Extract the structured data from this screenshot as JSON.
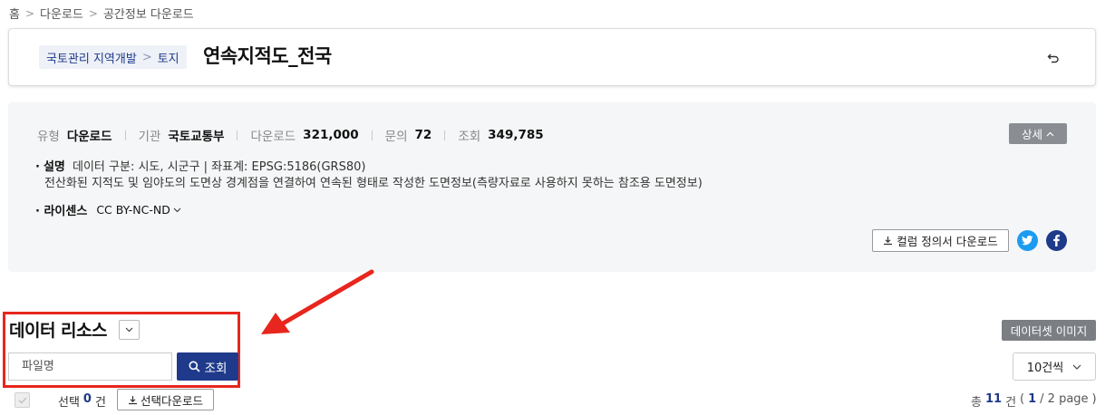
{
  "breadcrumb": [
    "홈",
    "다운로드",
    "공간정보 다운로드"
  ],
  "category": {
    "primary": "국토관리 지역개발",
    "secondary": "토지"
  },
  "page_title": "연속지적도_전국",
  "meta": {
    "type_label": "유형",
    "type_value": "다운로드",
    "org_label": "기관",
    "org_value": "국토교통부",
    "download_label": "다운로드",
    "download_value": "321,000",
    "inquiry_label": "문의",
    "inquiry_value": "72",
    "view_label": "조회",
    "view_value": "349,785"
  },
  "detail_button": "상세",
  "description": {
    "label": "설명",
    "line1": "데이터 구분: 시도, 시군구 | 좌표계: EPSG:5186(GRS80)",
    "line2": "전산화된 지적도 및 임야도의 도면상 경계점을 연결하여 연속된 형태로 작성한 도면정보(측량자료로 사용하지 못하는 참조용 도면정보)"
  },
  "license": {
    "label": "라이센스",
    "value": "CC BY-NC-ND"
  },
  "column_download_button": "컬럼 정의서 다운로드",
  "resource": {
    "title": "데이터 리소스",
    "search_placeholder": "파일명",
    "search_button": "조회",
    "image_button": "데이터셋 이미지",
    "page_size": "10건씩"
  },
  "selection": {
    "prefix": "선택",
    "count": "0",
    "suffix": "건",
    "download_button": "선택다운로드"
  },
  "total": {
    "prefix": "총",
    "count": "11",
    "unit": "건",
    "open": "(",
    "page": "1",
    "of": "/ 2 page",
    "close": ")"
  },
  "colors": {
    "accent": "#1f3a8a",
    "highlight": "#e8261d",
    "twitter": "#1d9bf0",
    "facebook": "#1e3a8a"
  }
}
